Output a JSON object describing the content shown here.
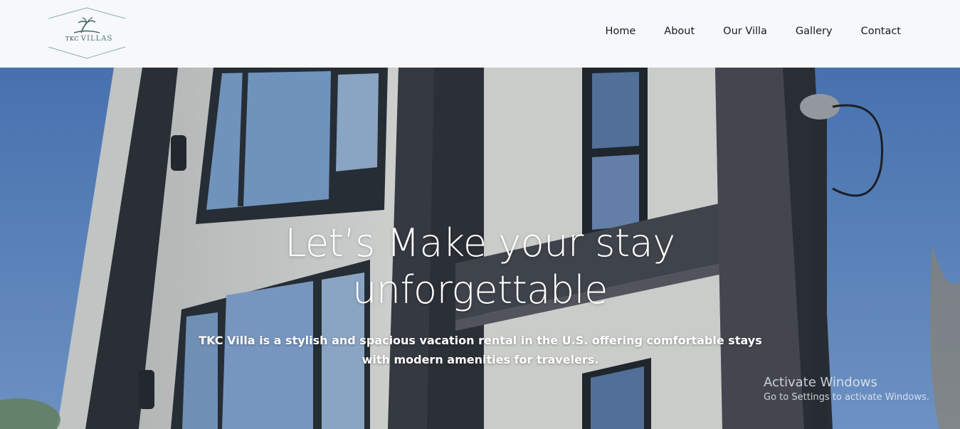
{
  "brand": {
    "logo_small": "TKC",
    "logo_big": "VILLAS"
  },
  "nav": {
    "items": [
      "Home",
      "About",
      "Our Villa",
      "Gallery",
      "Contact"
    ]
  },
  "hero": {
    "title_line1": "Let’s Make your stay",
    "title_line2": "unforgettable",
    "description": "TKC Villa is a stylish and spacious vacation rental in the U.S. offering comfortable stays with modern amenities for travelers."
  },
  "watermark": {
    "line1": "Activate Windows",
    "line2": "Go to Settings to activate Windows."
  },
  "colors": {
    "header_bg": "#f6f8fa",
    "logo_green": "#4d7567",
    "sky_blue": "#5e86c2",
    "text_white": "#ffffff"
  },
  "icons": [
    "palm-tree-icon"
  ]
}
